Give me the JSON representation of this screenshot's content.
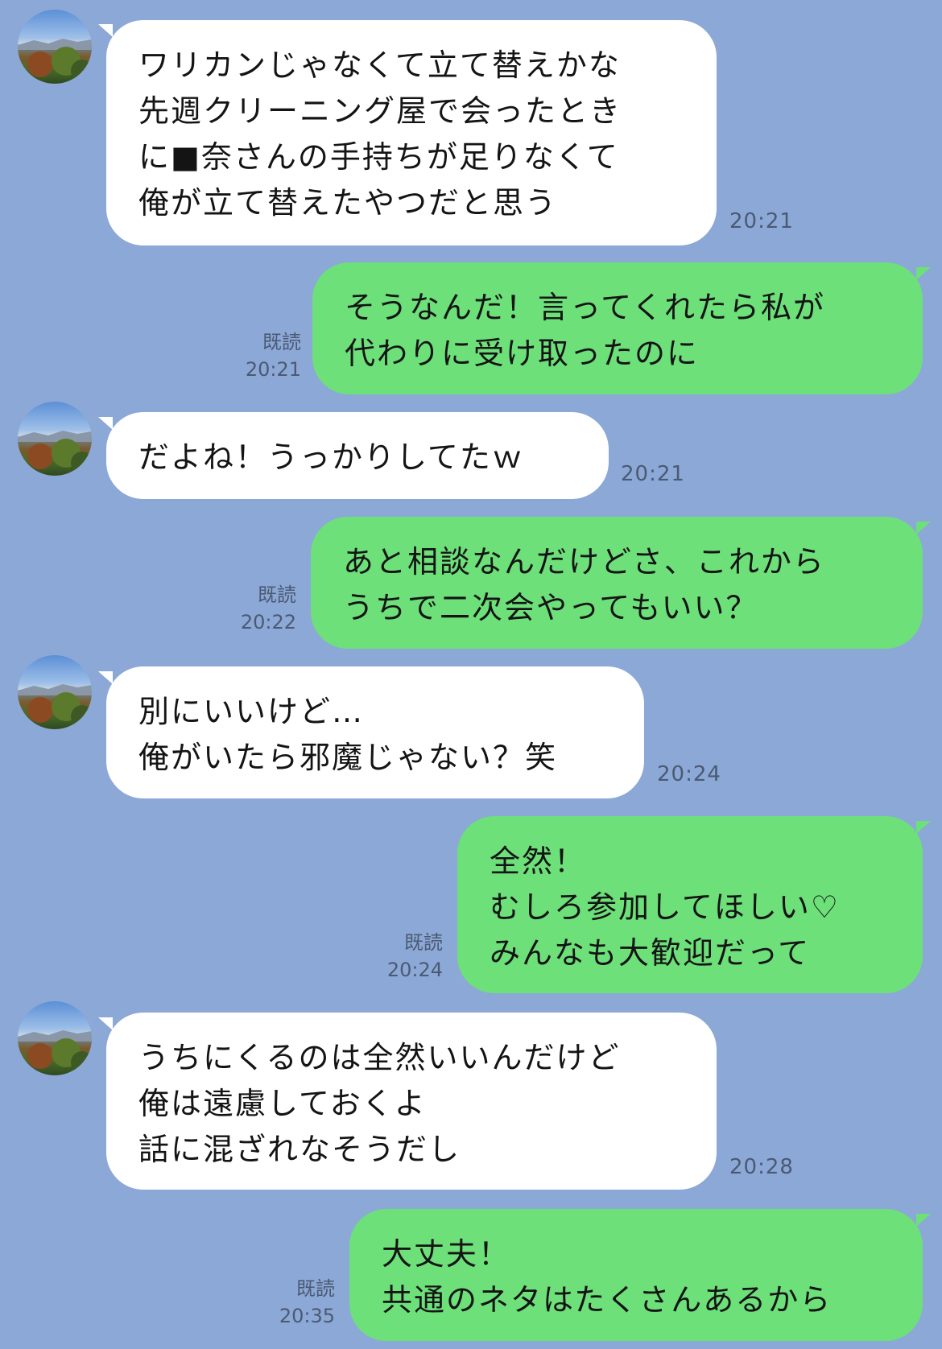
{
  "messages": [
    {
      "side": "in",
      "lines": [
        "ワリカンじゃなくて立て替えかな",
        "先週クリーニング屋で会ったとき",
        "に■奈さんの手持ちが足りなくて",
        "俺が立て替えたやつだと思う"
      ],
      "time": "20:21"
    },
    {
      "side": "out",
      "lines": [
        "そうなんだ！言ってくれたら私が",
        "代わりに受け取ったのに"
      ],
      "read": "既読",
      "time": "20:21"
    },
    {
      "side": "in",
      "lines": [
        "だよね！うっかりしてたｗ"
      ],
      "time": "20:21"
    },
    {
      "side": "out",
      "lines": [
        "あと相談なんだけどさ、これから",
        "うちで二次会やってもいい？"
      ],
      "read": "既読",
      "time": "20:22"
    },
    {
      "side": "in",
      "lines": [
        "別にいいけど…",
        "俺がいたら邪魔じゃない？笑"
      ],
      "time": "20:24"
    },
    {
      "side": "out",
      "lines": [
        "全然！",
        "むしろ参加してほしい♡",
        "みんなも大歓迎だって"
      ],
      "read": "既読",
      "time": "20:24"
    },
    {
      "side": "in",
      "lines": [
        "うちにくるのは全然いいんだけど",
        "俺は遠慮しておくよ",
        "話に混ざれなそうだし"
      ],
      "time": "20:28"
    },
    {
      "side": "out",
      "lines": [
        "大丈夫！",
        "共通のネタはたくさんあるから"
      ],
      "read": "既読",
      "time": "20:35"
    }
  ],
  "colors": {
    "background": "#8ca8d6",
    "incoming_bubble": "#ffffff",
    "outgoing_bubble": "#6de07a",
    "meta_text": "#4b5a73"
  },
  "icons": {
    "avatar": "contact-avatar-landscape-photo"
  }
}
